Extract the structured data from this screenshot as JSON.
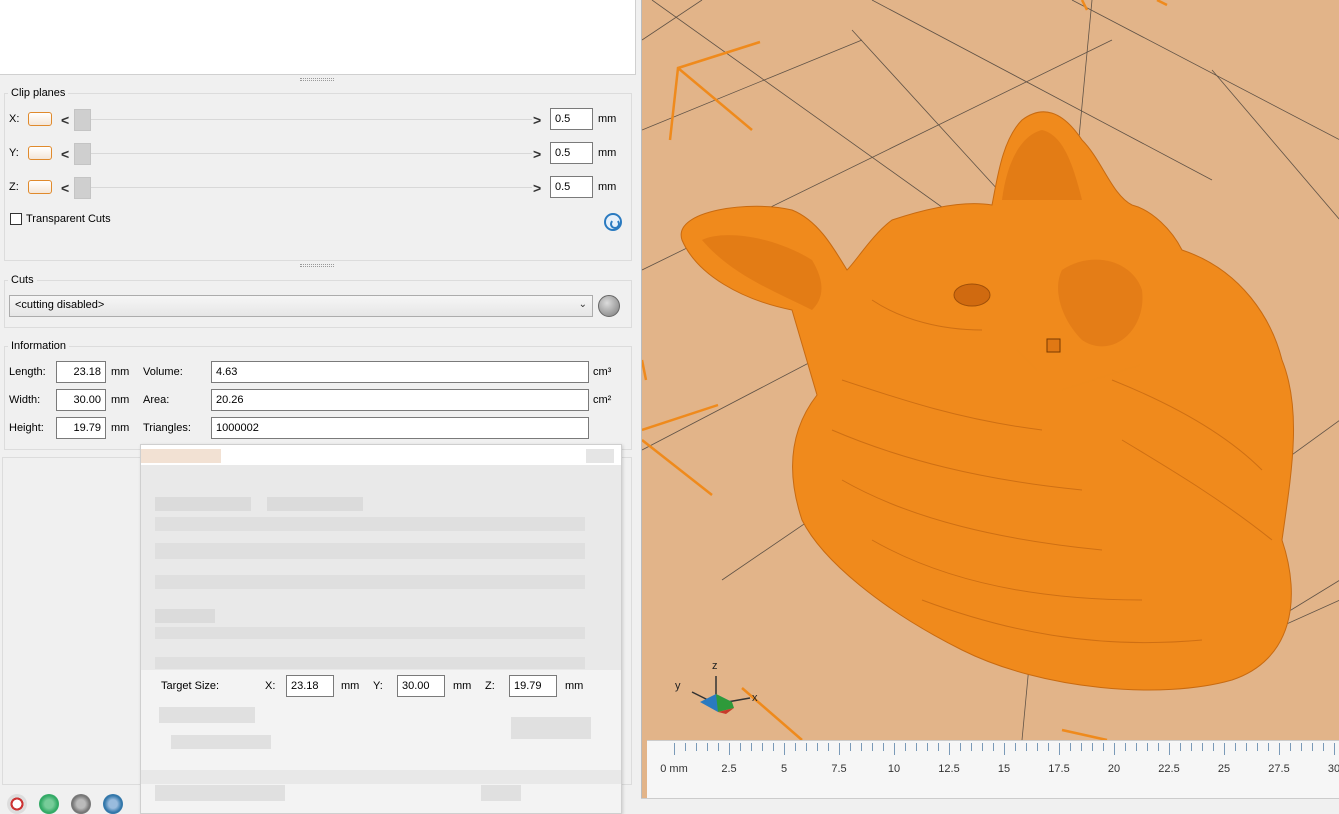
{
  "clip_planes": {
    "title": "Clip planes",
    "rows": [
      {
        "label": "X:",
        "value": "0.5",
        "unit": "mm"
      },
      {
        "label": "Y:",
        "value": "0.5",
        "unit": "mm"
      },
      {
        "label": "Z:",
        "value": "0.5",
        "unit": "mm"
      }
    ],
    "left_arrow": "<",
    "right_arrow": ">",
    "transparent_cuts_label": "Transparent Cuts"
  },
  "cuts": {
    "title": "Cuts",
    "selected": "<cutting disabled>"
  },
  "information": {
    "title": "Information",
    "length_label": "Length:",
    "length_value": "23.18",
    "width_label": "Width:",
    "width_value": "30.00",
    "height_label": "Height:",
    "height_value": "19.79",
    "mm": "mm",
    "volume_label": "Volume:",
    "volume_value": "4.63",
    "volume_unit": "cm³",
    "area_label": "Area:",
    "area_value": "20.26",
    "area_unit": "cm²",
    "triangles_label": "Triangles:",
    "triangles_value": "1000002"
  },
  "target_size": {
    "label": "Target Size:",
    "x_label": "X:",
    "x_value": "23.18",
    "y_label": "Y:",
    "y_value": "30.00",
    "z_label": "Z:",
    "z_value": "19.79",
    "unit": "mm"
  },
  "viewport": {
    "axis_x": "x",
    "axis_y": "y",
    "axis_z": "z",
    "ruler_labels": [
      "0 mm",
      "2.5",
      "5",
      "7.5",
      "10",
      "12.5",
      "15",
      "17.5",
      "20",
      "22.5",
      "25",
      "27.5",
      "30"
    ],
    "bed_color": "#e2b489",
    "model_color": "#f08a1c"
  }
}
